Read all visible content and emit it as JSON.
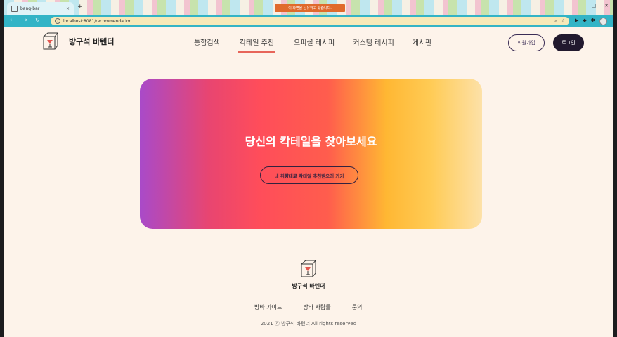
{
  "browser": {
    "tab_title": "bang-bar",
    "tab_close": "×",
    "new_tab": "+",
    "sharing_notice": "이 화면을 공유하고 있습니다.",
    "url": "localhost:8081/recommendation",
    "window_controls": [
      "—",
      "□",
      "✕"
    ],
    "nav": {
      "back": "←",
      "forward": "→",
      "reload": "↻"
    },
    "accent_color": "#33b4c6"
  },
  "header": {
    "brand": "방구석 바텐더",
    "nav_items": [
      {
        "label": "통합검색",
        "active": false
      },
      {
        "label": "칵테일 추천",
        "active": true
      },
      {
        "label": "오피셜 레시피",
        "active": false
      },
      {
        "label": "커스텀 레시피",
        "active": false
      },
      {
        "label": "게시판",
        "active": false
      }
    ],
    "signup_label": "회원가입",
    "login_label": "로그인"
  },
  "hero": {
    "title": "당신의 칵테일을 찾아보세요",
    "cta_label": "내 취향대로 칵테일 추천받으러 가기",
    "gradient": [
      "#a94ac9",
      "#ff4d5a",
      "#ffb733",
      "#fde1a8"
    ]
  },
  "footer": {
    "brand": "방구석 바텐더",
    "links": [
      "방바 가이드",
      "방바 사람들",
      "문의"
    ],
    "copyright": "2021 ⓒ 방구석 바텐더 All rights reserved"
  }
}
